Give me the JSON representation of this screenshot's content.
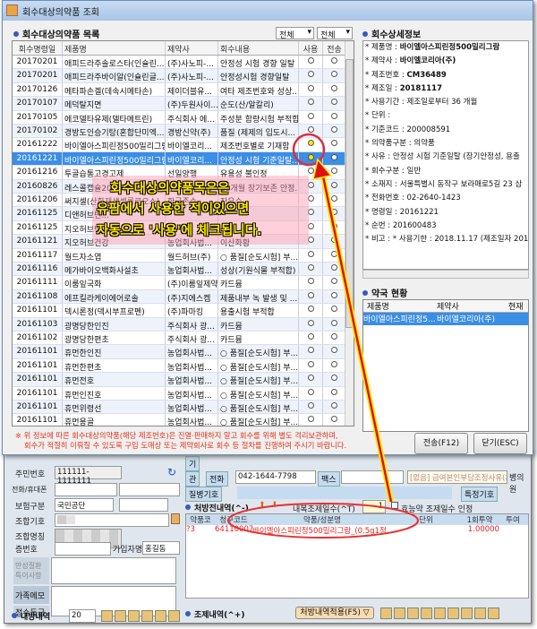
{
  "dialog": {
    "title": "회수대상의약품 조회",
    "list_title": "회수대상의약품 목록",
    "filter1": "전체",
    "filter2": "전체",
    "columns": [
      "회수명령일",
      "제품명",
      "제약사",
      "회수내용",
      "사용",
      "전송"
    ],
    "rows": [
      [
        "20170201",
        "애피드라주솔로스타(인슐린...",
        "(주)사노피-...",
        "안정성 시험 경향 일탈",
        false,
        false
      ],
      [
        "20170201",
        "애피드라주바이알(인슐린글...",
        "(주)사노피-...",
        "안정성시험 경향일탈",
        false,
        false
      ],
      [
        "20170126",
        "메타파손겔(데속시메타손)",
        "제이더블유...",
        "여타 제조번호와 성상...",
        false,
        false
      ],
      [
        "20170107",
        "메덕탈지면",
        "(주)두원사이...",
        "순도(산/알칼리)",
        false,
        false
      ],
      [
        "20170105",
        "에코델타유제(델타메트린)",
        "주식회사 에...",
        "주성분 함량시험 부적합",
        false,
        false
      ],
      [
        "20170102",
        "경방도인승기탕(혼합단미엑...",
        "경방신약(주)",
        "품질 (제제의 입도시...",
        false,
        false
      ],
      [
        "20161222",
        "바이엘아스피린정500밀리그람",
        "바이엘코리...",
        "제조번호별로 기재함",
        true,
        false
      ],
      [
        "20161221",
        "바이엘아스피린정500밀리그람",
        "바이엘코리...",
        "안정성 시험 기준일탈...",
        true,
        false
      ],
      [
        "20161216",
        "투골습통고경고제",
        "선일양행",
        "유용성 불인정",
        false,
        false
      ],
      [
        "20160826",
        "레스콜캡슐20밀리그람(플루...",
        "한국노바티...",
        "18개월 장기보존 안정...",
        false,
        false
      ],
      [
        "20161206",
        "써지셀(산화재생셀룰로오스)",
        "한국존슨...",
        "잔유수",
        false,
        false
      ],
      [
        "20161125",
        "디앤허브빈...",
        "",
        "",
        false,
        false
      ],
      [
        "20161125",
        "지오허브반...",
        "",
        "",
        false,
        false
      ],
      [
        "20161121",
        "지오허브건강",
        "농업회사법...",
        "이산화황",
        false,
        false
      ],
      [
        "20161117",
        "월드자소엽",
        "월드허브(주)",
        "○ 품질[순도시험] 부...",
        false,
        false
      ],
      [
        "20161116",
        "메가바이오백화사설초",
        "농업회사법...",
        "성상(기원식물 부적합)",
        false,
        false
      ],
      [
        "20161111",
        "이룸잎국화",
        "(주)이룸잎제약",
        "카드뮴",
        false,
        false
      ],
      [
        "20161108",
        "에프킬라케이에어로솔",
        "(주)지에스켐",
        "제품내부 녹 발생 및 ...",
        false,
        false
      ],
      [
        "20161101",
        "덱시론정(덱시부프로펜)",
        "(주)파마킹",
        "용출시험 부적합",
        false,
        false
      ],
      [
        "20161103",
        "광명당한인진",
        "주식회사 광...",
        "카드뮴",
        false,
        false
      ],
      [
        "20161102",
        "광명당한편초",
        "주식회사 광...",
        "카드뮴",
        false,
        false
      ],
      [
        "20161101",
        "휴먼한인진",
        "농업회사법...",
        "○ 품질[순도시험] 부...",
        false,
        false
      ],
      [
        "20161101",
        "휴먼한편초",
        "농업회사법...",
        "○ 품질[순도시험] 부...",
        false,
        false
      ],
      [
        "20161101",
        "휴먼전호",
        "농업회사법...",
        "○ 품질[순도시험] 부...",
        false,
        false
      ],
      [
        "20161101",
        "휴먼인진호",
        "농업회사법...",
        "○ 품질[순도시험] 부...",
        false,
        false
      ],
      [
        "20161101",
        "휴먼위령선",
        "농업회사법...",
        "○ 품질[순도시험] 부...",
        false,
        false
      ],
      [
        "20161101",
        "휴먼용골",
        "농업회사법...",
        "○ 품질[순도시험] 부...",
        false,
        false
      ]
    ],
    "selected_index": 7,
    "detail_title": "회수상세정보",
    "detail": [
      {
        "k": "* 제품명 : ",
        "v": "바이엘아스피린정500밀리그람",
        "b": true
      },
      {
        "k": "* 제약사 : ",
        "v": "바이엘코리아(주)",
        "b": true
      },
      {
        "k": "* 제조번호 : ",
        "v": "CM36489",
        "b": true
      },
      {
        "k": "* 제조일 : ",
        "v": "20181117",
        "b": true
      },
      {
        "k": "* 사용기간 : ",
        "v": "제조일로부터 36 개월",
        "b": false
      },
      {
        "k": "* 단위 : ",
        "v": "",
        "b": false
      },
      {
        "k": "* 기준코드 : ",
        "v": "200008591",
        "b": false
      },
      {
        "k": "* 의약품구분 : ",
        "v": "의약품",
        "b": false
      },
      {
        "k": "* 사유 : ",
        "v": "안정성 시험 기준일탈 (장기안정성, 용출",
        "b": false
      },
      {
        "k": "* 회수구분 : ",
        "v": "일반",
        "b": false
      },
      {
        "k": "* 소재지 : ",
        "v": "서울특별시 동작구  보라매로5길 23 삼",
        "b": false
      },
      {
        "k": "* 전화번호 : ",
        "v": "02-2640-1423",
        "b": false
      },
      {
        "k": "* 명령일 : ",
        "v": "20161221",
        "b": false
      },
      {
        "k": "* 순번 : ",
        "v": "201600483",
        "b": false
      },
      {
        "k": "* 비고 : ",
        "v": "* 사용기한 : 2018.11.17 (제조일자 2015.",
        "b": false
      }
    ],
    "pharmacy_title": "약국 현황",
    "pharmacy_columns": [
      "제품명",
      "제약사",
      "현재"
    ],
    "pharmacy_rows": [
      [
        "바이엘아스피린정5...",
        "바이엘코리아(주)",
        ""
      ]
    ],
    "notice": [
      "※ 위 정보에 따른 회수대상의약품(해당 제조번호)은 진열·판매하지 말고 회수를 위해 별도 격리보관하며,",
      "회수가 적절히 이뤄질 수 있도록 구입 도매상 또는 제약회사로 회수 등 절차를 진행하여 주시기 바랍니다."
    ],
    "send_button": "전송(F12)",
    "close_button": "닫기(ESC)"
  },
  "annotation": {
    "lines": [
      "회수대상의약품목은은",
      "유팜에서 사용한 적이있으면",
      "자동으로 '사용'에 체크됩니다."
    ]
  },
  "patient": {
    "rrn_label": "주민번호",
    "rrn": "111111-1111111",
    "phone_label": "전화/휴대폰",
    "insurance_label": "보험구분",
    "insurance": "국민공단",
    "union_code_label": "조합기호",
    "union_name_label": "조합명칭",
    "card_label": "증번호",
    "subscriber_label": "가입자명",
    "subscriber": "홍길동",
    "chronic_label": "만성질환 특이사항",
    "family_memo_label": "가족메모",
    "score_label": "점수등급",
    "history_label": "내방내역",
    "history_count": "20"
  },
  "clinic": {
    "gi": "기",
    "gwan": "관",
    "phone_label": "전화",
    "phone": "042-1644-7798",
    "fax_label": "팩스",
    "reason": "[없음] 급여본인부담조정사유(처방전 화",
    "hospital": "병의원",
    "disease_label": "질병기호",
    "special_label": "특정기호"
  },
  "rx": {
    "title": "처방전내역(^-)",
    "days_label": "내복조제일수(^T)",
    "days": "1",
    "efficacy_label": "효능약 조제일수 인정",
    "columns": [
      "약품코",
      "청구코드",
      "약품/성분명",
      "단위",
      "1회투약",
      "투여"
    ],
    "rows": [
      [
        "?3",
        "641100070",
        "바이엘아스피린정500밀리그람_(0.5g1정",
        "",
        "1.00000",
        ""
      ]
    ]
  },
  "dispense": {
    "title": "조제내역(^+)",
    "apply_button": "처방내역적용(F5) ▽"
  }
}
